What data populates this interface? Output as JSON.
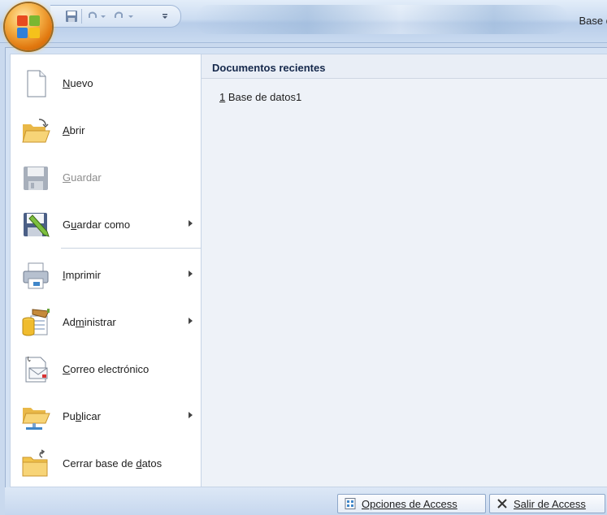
{
  "window": {
    "title": "Base d"
  },
  "quick_access_toolbar": {
    "icons": [
      "save-icon",
      "undo-icon",
      "undo-dropdown-icon",
      "redo-icon",
      "redo-dropdown-icon",
      "customize-icon"
    ]
  },
  "menu": {
    "items": [
      {
        "label": "Nuevo",
        "access_key": "N",
        "icon": "new-document-icon",
        "has_submenu": false,
        "enabled": true
      },
      {
        "label": "Abrir",
        "access_key": "A",
        "icon": "open-folder-icon",
        "has_submenu": false,
        "enabled": true
      },
      {
        "label": "Guardar",
        "access_key": "G",
        "icon": "save-disk-icon",
        "has_submenu": false,
        "enabled": false
      },
      {
        "label": "Guardar como",
        "access_key": "u",
        "icon": "save-as-icon",
        "has_submenu": true,
        "enabled": true
      },
      {
        "label": "Imprimir",
        "access_key": "I",
        "icon": "printer-icon",
        "has_submenu": true,
        "enabled": true
      },
      {
        "label": "Administrar",
        "access_key": "m",
        "icon": "manage-database-icon",
        "has_submenu": true,
        "enabled": true
      },
      {
        "label": "Correo electrónico",
        "access_key": "C",
        "icon": "email-icon",
        "has_submenu": false,
        "enabled": true
      },
      {
        "label": "Publicar",
        "access_key": "b",
        "icon": "publish-folder-icon",
        "has_submenu": true,
        "enabled": true
      },
      {
        "label": "Cerrar base de datos",
        "access_key": "d",
        "icon": "close-database-icon",
        "has_submenu": false,
        "enabled": true
      }
    ]
  },
  "recent": {
    "header": "Documentos recientes",
    "items": [
      {
        "number": "1",
        "name": " Base de datos1"
      }
    ]
  },
  "footer": {
    "options_label": "Opciones de Access",
    "exit_label": "Salir de Access"
  },
  "colors": {
    "accent": "#e1780f",
    "frame": "#d4e2f4",
    "header_text": "#15284b"
  }
}
